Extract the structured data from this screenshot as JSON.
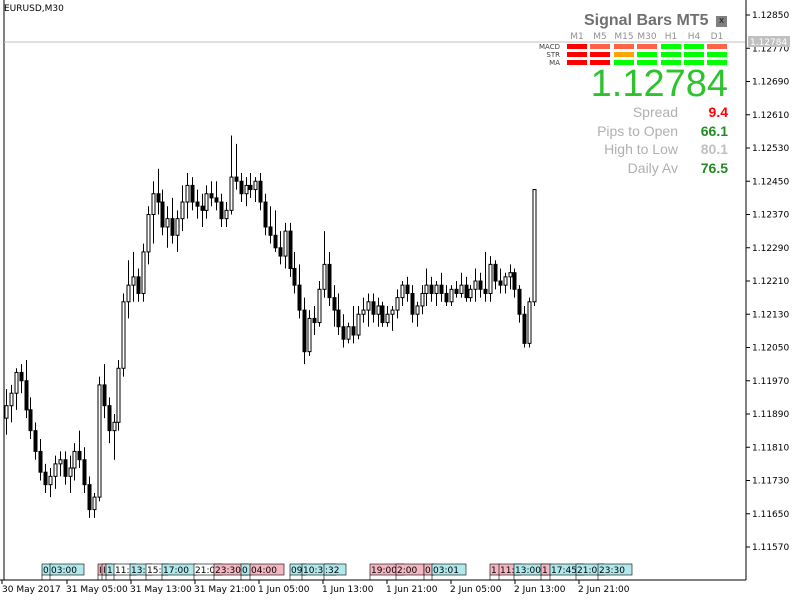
{
  "window": {
    "symbol_label": "EURUSD,M30"
  },
  "panel": {
    "title": "Signal Bars MT5",
    "close_label": "x",
    "timeframes": [
      "M1",
      "M5",
      "M15",
      "M30",
      "H1",
      "H4",
      "D1"
    ],
    "rows": [
      {
        "label": "MACD",
        "signals": [
          "red",
          "salmon",
          "salmon",
          "salmon",
          "green",
          "green",
          "salmon"
        ]
      },
      {
        "label": "STR",
        "signals": [
          "red",
          "red",
          "orange",
          "green",
          "green",
          "green",
          "green"
        ]
      },
      {
        "label": "MA",
        "signals": [
          "red",
          "red",
          "green",
          "green",
          "green",
          "green",
          "green"
        ]
      }
    ],
    "signal_colors": {
      "red": "#ff0000",
      "salmon": "#ff6347",
      "orange": "#ffa500",
      "green": "#00ff00"
    },
    "price": "1.12784",
    "price_color": "#2ec32e",
    "stats": [
      {
        "label": "Spread",
        "value": "9.4",
        "color": "#ff0000"
      },
      {
        "label": "Pips to Open",
        "value": "66.1",
        "color": "#228b22"
      },
      {
        "label": "High to Low",
        "value": "80.1",
        "color": "#c0c0c0"
      },
      {
        "label": "Daily Av",
        "value": "76.5",
        "color": "#228b22"
      }
    ]
  },
  "chart_data": {
    "type": "candlestick",
    "title": "EURUSD,M30",
    "current_price": 1.12784,
    "current_price_label": "1.12784",
    "ylim": [
      1.11505,
      1.12895
    ],
    "y_ticks": [
      "1.12850",
      "1.12770",
      "1.12690",
      "1.12610",
      "1.12530",
      "1.12450",
      "1.12370",
      "1.12290",
      "1.12210",
      "1.12130",
      "1.12050",
      "1.11970",
      "1.11890",
      "1.11810",
      "1.11730",
      "1.11650",
      "1.11570"
    ],
    "x_ticks": [
      "30 May 2017",
      "31 May 05:00",
      "31 May 13:00",
      "31 May 21:00",
      "1 Jun 05:00",
      "1 Jun 13:00",
      "1 Jun 21:00",
      "2 Jun 05:00",
      "2 Jun 13:00",
      "2 Jun 21:00"
    ],
    "grid": false,
    "candles": [
      [
        1.1188,
        1.1195,
        1.1184,
        1.1191
      ],
      [
        1.1191,
        1.1196,
        1.1187,
        1.1194
      ],
      [
        1.1194,
        1.12,
        1.119,
        1.1199
      ],
      [
        1.1199,
        1.1201,
        1.1194,
        1.1197
      ],
      [
        1.1197,
        1.1202,
        1.1188,
        1.119
      ],
      [
        1.119,
        1.1193,
        1.1183,
        1.1185
      ],
      [
        1.1185,
        1.1187,
        1.1178,
        1.118
      ],
      [
        1.118,
        1.1183,
        1.1173,
        1.1175
      ],
      [
        1.1175,
        1.1177,
        1.117,
        1.1172
      ],
      [
        1.1172,
        1.1176,
        1.1169,
        1.1174
      ],
      [
        1.1174,
        1.1179,
        1.1171,
        1.1177
      ],
      [
        1.1177,
        1.118,
        1.1174,
        1.1178
      ],
      [
        1.1178,
        1.118,
        1.1172,
        1.1174
      ],
      [
        1.1174,
        1.1179,
        1.117,
        1.1176
      ],
      [
        1.1176,
        1.1182,
        1.1173,
        1.118
      ],
      [
        1.118,
        1.1185,
        1.1176,
        1.1178
      ],
      [
        1.1178,
        1.1181,
        1.117,
        1.1172
      ],
      [
        1.1172,
        1.1174,
        1.1164,
        1.1166
      ],
      [
        1.1166,
        1.117,
        1.1164,
        1.1169
      ],
      [
        1.1169,
        1.1198,
        1.1168,
        1.1196
      ],
      [
        1.1196,
        1.1201,
        1.1188,
        1.1191
      ],
      [
        1.1191,
        1.1193,
        1.1182,
        1.1185
      ],
      [
        1.1185,
        1.1189,
        1.1178,
        1.1187
      ],
      [
        1.1187,
        1.1202,
        1.1185,
        1.12
      ],
      [
        1.12,
        1.1218,
        1.1198,
        1.1216
      ],
      [
        1.1216,
        1.1226,
        1.1212,
        1.122
      ],
      [
        1.122,
        1.1228,
        1.1216,
        1.1222
      ],
      [
        1.1222,
        1.1224,
        1.1216,
        1.1218
      ],
      [
        1.1218,
        1.123,
        1.1216,
        1.1228
      ],
      [
        1.1228,
        1.1239,
        1.1225,
        1.1237
      ],
      [
        1.1237,
        1.1245,
        1.123,
        1.1242
      ],
      [
        1.1242,
        1.1248,
        1.1237,
        1.124
      ],
      [
        1.124,
        1.1243,
        1.1232,
        1.1234
      ],
      [
        1.1234,
        1.1239,
        1.1229,
        1.1236
      ],
      [
        1.1236,
        1.1241,
        1.123,
        1.1232
      ],
      [
        1.1232,
        1.1238,
        1.1228,
        1.1236
      ],
      [
        1.1236,
        1.1244,
        1.1233,
        1.124
      ],
      [
        1.124,
        1.1247,
        1.1236,
        1.1244
      ],
      [
        1.1244,
        1.1246,
        1.1238,
        1.124
      ],
      [
        1.124,
        1.1243,
        1.1236,
        1.1239
      ],
      [
        1.1239,
        1.1242,
        1.1234,
        1.1238
      ],
      [
        1.1238,
        1.1244,
        1.1236,
        1.1242
      ],
      [
        1.1242,
        1.1245,
        1.1239,
        1.1241
      ],
      [
        1.1241,
        1.1245,
        1.1238,
        1.124
      ],
      [
        1.124,
        1.1242,
        1.1234,
        1.1236
      ],
      [
        1.1236,
        1.124,
        1.1234,
        1.1238
      ],
      [
        1.1238,
        1.1256,
        1.1237,
        1.1246
      ],
      [
        1.1246,
        1.1254,
        1.1243,
        1.1245
      ],
      [
        1.1245,
        1.1247,
        1.124,
        1.1242
      ],
      [
        1.1242,
        1.1246,
        1.1239,
        1.1244
      ],
      [
        1.1244,
        1.1247,
        1.1241,
        1.1243
      ],
      [
        1.1243,
        1.1246,
        1.124,
        1.1245
      ],
      [
        1.1245,
        1.1247,
        1.1238,
        1.124
      ],
      [
        1.124,
        1.1242,
        1.1232,
        1.1234
      ],
      [
        1.1234,
        1.1239,
        1.123,
        1.1232
      ],
      [
        1.1232,
        1.1238,
        1.1228,
        1.1229
      ],
      [
        1.1229,
        1.1233,
        1.1225,
        1.1227
      ],
      [
        1.1227,
        1.1235,
        1.1224,
        1.1233
      ],
      [
        1.1233,
        1.1235,
        1.1222,
        1.1224
      ],
      [
        1.1224,
        1.1228,
        1.1218,
        1.122
      ],
      [
        1.122,
        1.1225,
        1.1212,
        1.1214
      ],
      [
        1.1214,
        1.1217,
        1.1201,
        1.1204
      ],
      [
        1.1204,
        1.1214,
        1.1203,
        1.1212
      ],
      [
        1.1212,
        1.1215,
        1.1208,
        1.1211
      ],
      [
        1.1211,
        1.1221,
        1.121,
        1.1219
      ],
      [
        1.1219,
        1.1233,
        1.1217,
        1.1225
      ],
      [
        1.1225,
        1.1228,
        1.1215,
        1.1217
      ],
      [
        1.1217,
        1.122,
        1.121,
        1.1214
      ],
      [
        1.1214,
        1.1218,
        1.1208,
        1.121
      ],
      [
        1.121,
        1.1213,
        1.1205,
        1.1207
      ],
      [
        1.1207,
        1.1211,
        1.1206,
        1.121
      ],
      [
        1.121,
        1.1215,
        1.1206,
        1.1208
      ],
      [
        1.1208,
        1.1215,
        1.1207,
        1.1213
      ],
      [
        1.1213,
        1.1217,
        1.1211,
        1.1214
      ],
      [
        1.1214,
        1.1218,
        1.121,
        1.1216
      ],
      [
        1.1216,
        1.1218,
        1.1211,
        1.1213
      ],
      [
        1.1213,
        1.1217,
        1.121,
        1.1215
      ],
      [
        1.1215,
        1.1216,
        1.121,
        1.1211
      ],
      [
        1.1211,
        1.1215,
        1.121,
        1.1213
      ],
      [
        1.1213,
        1.1215,
        1.1209,
        1.1214
      ],
      [
        1.1214,
        1.1219,
        1.1212,
        1.1217
      ],
      [
        1.1217,
        1.1221,
        1.1215,
        1.122
      ],
      [
        1.122,
        1.1222,
        1.1216,
        1.1218
      ],
      [
        1.1218,
        1.122,
        1.1211,
        1.1213
      ],
      [
        1.1213,
        1.1216,
        1.121,
        1.1215
      ],
      [
        1.1215,
        1.122,
        1.1213,
        1.1218
      ],
      [
        1.1218,
        1.1224,
        1.1215,
        1.122
      ],
      [
        1.122,
        1.1222,
        1.1216,
        1.1218
      ],
      [
        1.1218,
        1.1221,
        1.1215,
        1.122
      ],
      [
        1.122,
        1.1223,
        1.1216,
        1.1218
      ],
      [
        1.1218,
        1.122,
        1.1215,
        1.1216
      ],
      [
        1.1216,
        1.122,
        1.1215,
        1.1219
      ],
      [
        1.1219,
        1.1221,
        1.1217,
        1.1218
      ],
      [
        1.1218,
        1.1223,
        1.1217,
        1.122
      ],
      [
        1.122,
        1.1222,
        1.1216,
        1.1217
      ],
      [
        1.1217,
        1.122,
        1.1216,
        1.1219
      ],
      [
        1.1219,
        1.1224,
        1.1216,
        1.1221
      ],
      [
        1.1221,
        1.1223,
        1.1217,
        1.1219
      ],
      [
        1.1219,
        1.1228,
        1.1216,
        1.1218
      ],
      [
        1.1218,
        1.1227,
        1.1216,
        1.1225
      ],
      [
        1.1225,
        1.1226,
        1.1219,
        1.1221
      ],
      [
        1.1221,
        1.1224,
        1.1218,
        1.122
      ],
      [
        1.122,
        1.1223,
        1.1218,
        1.1222
      ],
      [
        1.1222,
        1.1225,
        1.1219,
        1.1223
      ],
      [
        1.1223,
        1.1224,
        1.1217,
        1.1219
      ],
      [
        1.1219,
        1.122,
        1.1211,
        1.1213
      ],
      [
        1.1213,
        1.1215,
        1.1205,
        1.1206
      ],
      [
        1.1206,
        1.1217,
        1.1205,
        1.1216
      ],
      [
        1.1216,
        1.1243,
        1.1215,
        1.1243
      ]
    ],
    "bottom_markers": [
      {
        "label": "0",
        "color": "cyan"
      },
      {
        "label": "03:00",
        "color": "cyan"
      },
      {
        "label": "I",
        "color": "pink"
      },
      {
        "label": "I",
        "color": "pink"
      },
      {
        "label": "1",
        "color": "cyan"
      },
      {
        "label": "11:",
        "color": "white"
      },
      {
        "label": "13:",
        "color": "cyan"
      },
      {
        "label": "15:",
        "color": "white"
      },
      {
        "label": "17:00",
        "color": "cyan"
      },
      {
        "label": "21:0",
        "color": "white"
      },
      {
        "label": "23:30",
        "color": "pink"
      },
      {
        "label": "0",
        "color": "cyan"
      },
      {
        "label": "04:00",
        "color": "pink"
      },
      {
        "label": "09",
        "color": "cyan"
      },
      {
        "label": "10:32",
        "color": "cyan"
      },
      {
        "label": ":32",
        "color": "cyan"
      },
      {
        "label": "19:00",
        "color": "pink"
      },
      {
        "label": "2:00",
        "color": "pink"
      },
      {
        "label": "0",
        "color": "pink"
      },
      {
        "label": "03:01",
        "color": "cyan"
      },
      {
        "label": "1",
        "color": "pink"
      },
      {
        "label": "11:",
        "color": "pink"
      },
      {
        "label": "13:00",
        "color": "cyan"
      },
      {
        "label": "1",
        "color": "pink"
      },
      {
        "label": "17:45",
        "color": "cyan"
      },
      {
        "label": "21:0",
        "color": "cyan"
      },
      {
        "label": "23:30",
        "color": "cyan"
      }
    ]
  }
}
